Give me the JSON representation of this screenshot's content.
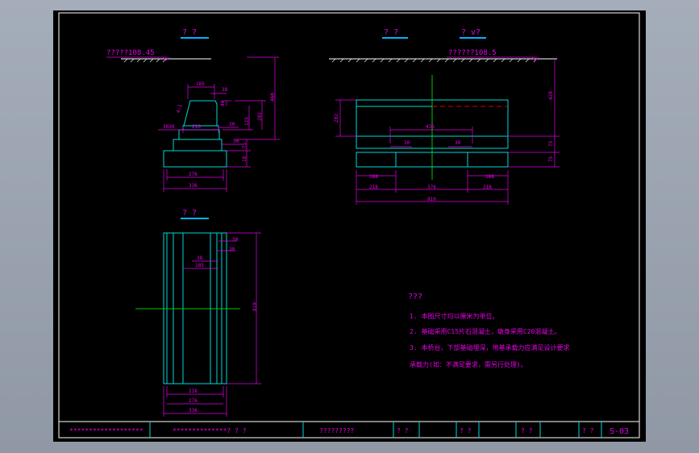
{
  "views": {
    "side_title": "?  ?",
    "front_title": "?  ?",
    "plan_title": "?  v?",
    "top_title": "?  ?"
  },
  "elevations": {
    "side": "?????108.45",
    "front": "??????108.5"
  },
  "side_dims": {
    "d185": "185",
    "d38": "38",
    "d40": "40",
    "d460": "460",
    "d202": "202",
    "d125": "125",
    "d216": "216",
    "d30": "30",
    "d3030": "3030",
    "d75": "75",
    "d18": "18",
    "d276": "276",
    "d336": "336",
    "slope": "4:1"
  },
  "front_dims": {
    "d202": "202",
    "d436": "436",
    "d428": "428",
    "d75a": "75",
    "d75b": "75",
    "d30a": "30",
    "d30b": "30",
    "d188a": "188",
    "d188b": "188",
    "d218a": "218",
    "d376": "376",
    "d218b": "218",
    "d810": "810"
  },
  "top_dims": {
    "d30a": "30",
    "d30b": "30",
    "d38": "38",
    "d185": "185",
    "d810": "810",
    "d216": "216",
    "d276": "276",
    "d336": "336"
  },
  "notes": {
    "heading": "???",
    "line1": "1. 本图尺寸均以厘米为单位。",
    "line2": "2. 基础采用C15片石混凝土，墩身采用C20混凝土。",
    "line3": "3. 本桥台，下部基础埋深，地基承载力应满足设计要求",
    "line4": "   承载力(如：不满足要求，需另行处理)。"
  },
  "title_block": {
    "cell1": "*******************",
    "cell2": "**************? ? ?",
    "cell3": "?????????",
    "cell4": "? ?",
    "cell5": "? ?",
    "cell6": "? ?",
    "cell7": "? ?",
    "sheet_no": "S-03"
  },
  "colors": {
    "cyan": "#00d7d7",
    "magenta": "#e600e6",
    "white": "#ffffff",
    "green": "#00c800",
    "red": "#e00000",
    "title_underline": "#00b4ff"
  }
}
